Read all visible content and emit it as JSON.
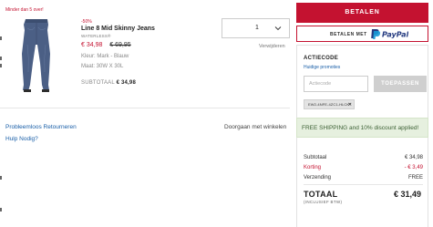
{
  "cart_item": {
    "stock_note": "Minder dan 5 over!",
    "discount_pct": "-50%",
    "name": "Line 8 Mid Skinny Jeans",
    "subtitle": "WATERLESS®",
    "price_new": "€ 34,98",
    "price_old": "€ 69,95",
    "color": "Kleur: Mark - Blauw",
    "size": "Maat: 30W X 30L",
    "subtotal_label": "SUBTOTAAL",
    "subtotal_value": "€ 34,98",
    "quantity": "1",
    "remove_label": "Verwijderen",
    "image_icon": "jeans-product-image"
  },
  "links": {
    "returns": "Probleemloos Retourneren",
    "help": "Hulp Nodig?",
    "continue": "Doorgaan met winkelen"
  },
  "checkout": {
    "pay_label": "BETALEN",
    "paypal_prefix": "BETALEN MET",
    "paypal_logo": "PayPal"
  },
  "promo": {
    "title": "ACTIECODE",
    "promotions_link": "Huidige promoties",
    "input_placeholder": "Actiecode",
    "apply_label": "TOEPASSEN",
    "applied_code": "EW2-4NFE-4ZC1-HLCK",
    "banner": "FREE SHIPPING and 10% discount applied!"
  },
  "summary": {
    "subtotal_label": "Subtotaal",
    "subtotal_value": "€ 34,98",
    "discount_label": "Korting",
    "discount_value": "- € 3,49",
    "shipping_label": "Verzending",
    "shipping_value": "FREE",
    "total_label": "TOTAAL",
    "total_note": "(INCLUSIEF BTW)",
    "total_value": "€ 31,49"
  },
  "colors": {
    "accent_red": "#c41230",
    "link_blue": "#1a5fa8",
    "paypal_dark": "#253b80",
    "paypal_light": "#179bd7",
    "banner_green": "#e6f0df"
  }
}
